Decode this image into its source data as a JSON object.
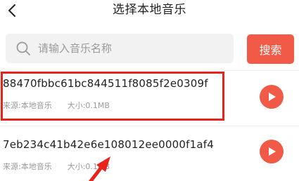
{
  "header": {
    "title": "选择本地音乐",
    "back_icon": "chevron-left-icon"
  },
  "search": {
    "placeholder": "请输入音乐名称",
    "value": "",
    "button_label": "搜索",
    "icon": "search-icon"
  },
  "songs": [
    {
      "name": "88470fbbc61bc844511f8085f2e0309f",
      "source": "来源:本地音乐",
      "size": "大小:0.1MB"
    },
    {
      "name": "7eb234c41b42e6e108012ee0000f1af4",
      "source": "来源:本地音乐",
      "size": "大小:0.1MB"
    }
  ],
  "colors": {
    "accent": "#f05a46",
    "annotation": "#e8231a",
    "search_bg": "#f2f2f2",
    "meta_text": "#9a9a9a"
  },
  "annotations": {
    "highlight": "red-rectangle around first song",
    "arrow": "red arrow pointing at second song name"
  }
}
